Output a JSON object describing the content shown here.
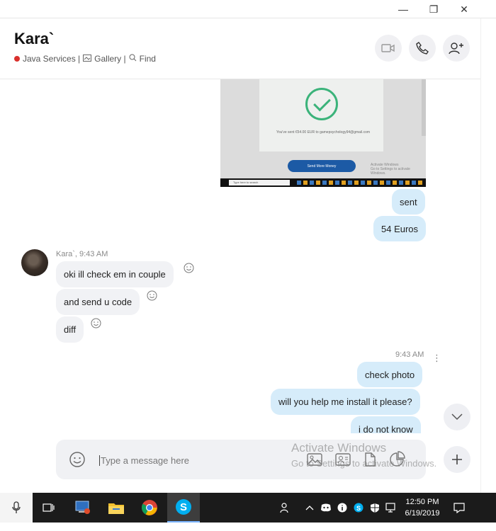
{
  "window": {
    "minimize": "—",
    "maximize": "❐",
    "close": "✕"
  },
  "header": {
    "name": "Kara`",
    "status": "Java  Services |",
    "gallery": "Gallery |",
    "find": "Find"
  },
  "screenshot": {
    "confirm_text": "You've sent €54.00 EUR to gamepsychology94@gmail.com",
    "button": "Send More Money",
    "activate1": "Activate Windows",
    "activate2": "Go to Settings to activate Windows.",
    "search": "Type here to search"
  },
  "messages": {
    "out1": "sent",
    "out2": "54 Euros",
    "in_meta": "Kara`, 9:43 AM",
    "in1": "oki ill check em in couple",
    "in2": "and send u code",
    "in3": "diff",
    "out_meta": "9:43 AM",
    "out3": "check photo",
    "out4": "will you help me install it please?",
    "out5": "i do not know"
  },
  "composer": {
    "placeholder": "Type a message here"
  },
  "watermark": {
    "line1": "Activate Windows",
    "line2": "Go to Settings to activate Windows."
  },
  "taskbar": {
    "time": "12:50 PM",
    "date": "6/19/2019"
  },
  "colors": {
    "outgoing": "#d6ecfa",
    "incoming": "#f1f2f5",
    "accent": "#0078d4"
  }
}
